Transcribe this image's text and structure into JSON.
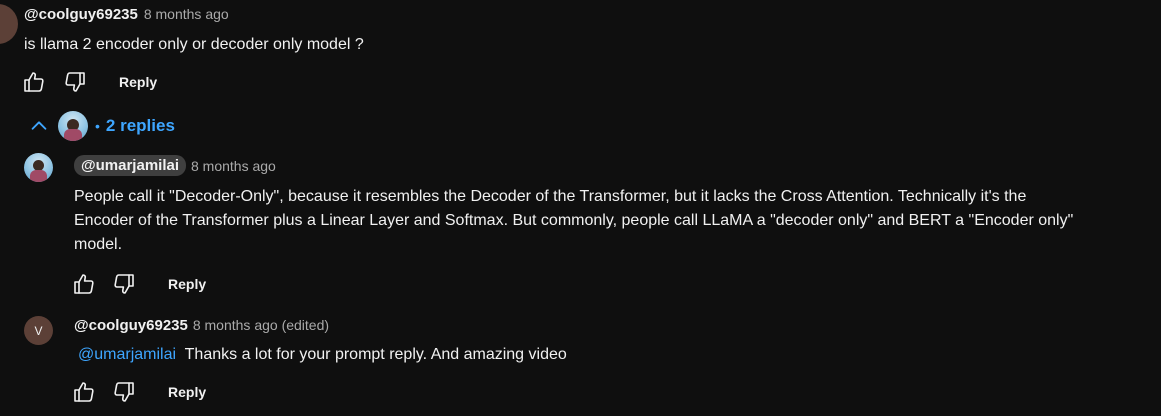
{
  "top_comment": {
    "author": "@coolguy69235",
    "time": "8 months ago",
    "text": "is llama 2 encoder only or decoder only model ?",
    "reply_label": "Reply"
  },
  "replies_toggle": {
    "label": "2 replies",
    "separator": "•"
  },
  "replies": [
    {
      "author": "@umarjamilai",
      "time": "8 months ago",
      "text_line1": "People call it \"Decoder-Only\", because it resembles the Decoder of the Transformer, but it lacks the Cross Attention. Technically it's the",
      "text_line2": "Encoder of the Transformer plus a Linear Layer and Softmax. But commonly, people call LLaMA a \"decoder only\" and BERT a \"Encoder only\"",
      "text_line3": "model.",
      "reply_label": "Reply"
    },
    {
      "author": "@coolguy69235",
      "avatar_letter": "V",
      "time": "8 months ago (edited)",
      "mention": "@umarjamilai",
      "text": "Thanks a lot for your prompt reply. And amazing video",
      "reply_label": "Reply"
    }
  ],
  "colors": {
    "background": "#0f0f0f",
    "text": "#f1f1f1",
    "muted": "#aaaaaa",
    "link": "#3ea6ff",
    "avatar_v": "#5c4037"
  },
  "icons": [
    "like-icon",
    "dislike-icon",
    "chevron-up-icon"
  ]
}
